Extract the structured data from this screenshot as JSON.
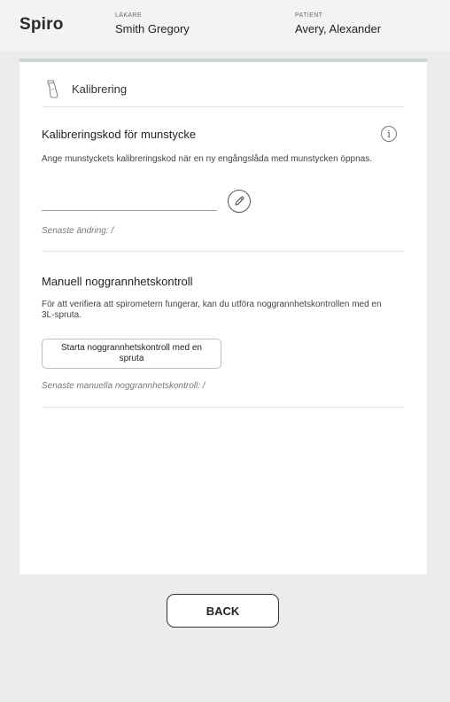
{
  "header": {
    "app_name": "Spiro",
    "doctor_label": "LÄKARE",
    "doctor_name": "Smith Gregory",
    "patient_label": "PATIENT",
    "patient_name": "Avery, Alexander"
  },
  "card": {
    "title": "Kalibrering",
    "title_icon": "mouthpiece-icon"
  },
  "calibration": {
    "title": "Kalibreringskod för munstycke",
    "description": "Ange munstyckets kalibreringskod när en ny engångslåda med munstycken öppnas.",
    "input_value": "",
    "last_change": "Senaste ändring: /",
    "info_icon": "info-icon",
    "info_glyph": "i",
    "edit_icon": "pencil-icon"
  },
  "accuracy": {
    "title": "Manuell noggrannhetskontroll",
    "description": "För att verifiera att spirometern fungerar, kan du utföra noggrannhetskontrollen med en 3L-spruta.",
    "button_label": "Starta noggrannhetskontroll med en spruta",
    "last_check": "Senaste manuella noggrannhetskontroll: /"
  },
  "footer": {
    "back_label": "BACK"
  }
}
